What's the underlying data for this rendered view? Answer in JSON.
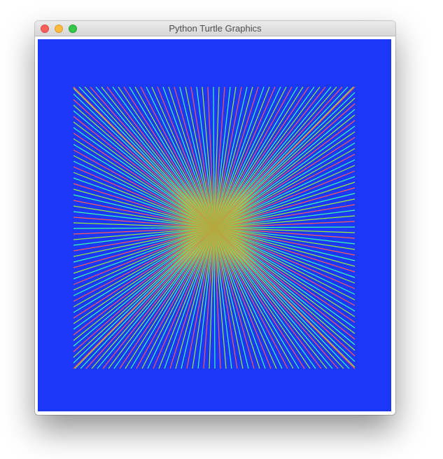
{
  "window": {
    "title": "Python Turtle Graphics"
  },
  "canvas": {
    "background_color": "#1a38f5",
    "pattern": "radial-lines-square",
    "line_colors": [
      "#ff5a5a",
      "#3affb0",
      "#9aef3a"
    ],
    "center_glow_color": "#b6a83a"
  },
  "icons": {
    "close": "close-icon",
    "minimize": "minimize-icon",
    "maximize": "maximize-icon"
  }
}
